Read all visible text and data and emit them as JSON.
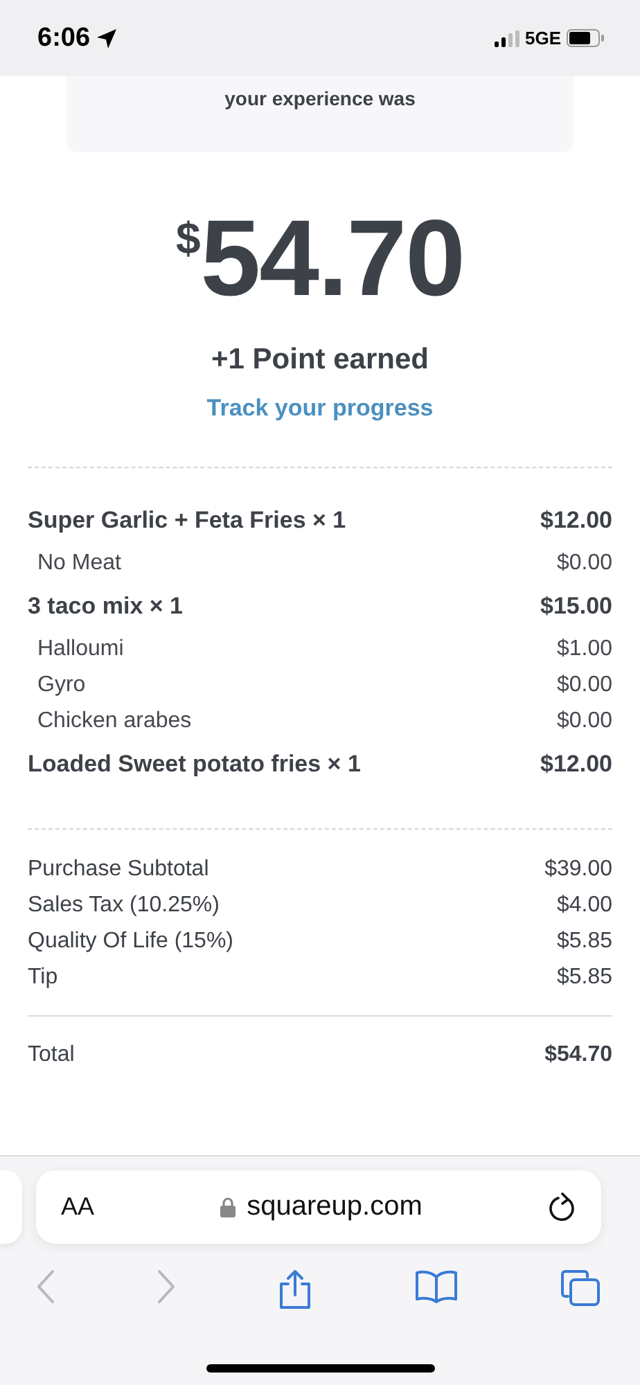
{
  "status_bar": {
    "time": "6:06",
    "network": "5GE"
  },
  "feedback_card": {
    "text": "your experience was"
  },
  "amount": {
    "currency": "$",
    "value": "54.70"
  },
  "points": "+1 Point earned",
  "track_link": "Track your progress",
  "items": [
    {
      "kind": "item",
      "name": "Super Garlic + Feta Fries × 1",
      "price": "$12.00"
    },
    {
      "kind": "modifier",
      "name": "No Meat",
      "price": "$0.00"
    },
    {
      "kind": "item",
      "name": "3 taco mix × 1",
      "price": "$15.00"
    },
    {
      "kind": "modifier",
      "name": "Halloumi",
      "price": "$1.00"
    },
    {
      "kind": "modifier",
      "name": "Gyro",
      "price": "$0.00"
    },
    {
      "kind": "modifier",
      "name": "Chicken arabes",
      "price": "$0.00"
    },
    {
      "kind": "item",
      "name": "Loaded Sweet potato fries × 1",
      "price": "$12.00"
    }
  ],
  "summary": [
    {
      "label": "Purchase Subtotal",
      "value": "$39.00"
    },
    {
      "label": "Sales Tax (10.25%)",
      "value": "$4.00"
    },
    {
      "label": "Quality Of Life (15%)",
      "value": "$5.85"
    },
    {
      "label": "Tip",
      "value": "$5.85"
    }
  ],
  "total": {
    "label": "Total",
    "value": "$54.70"
  },
  "browser": {
    "text_size": "AA",
    "url": "squareup.com"
  }
}
